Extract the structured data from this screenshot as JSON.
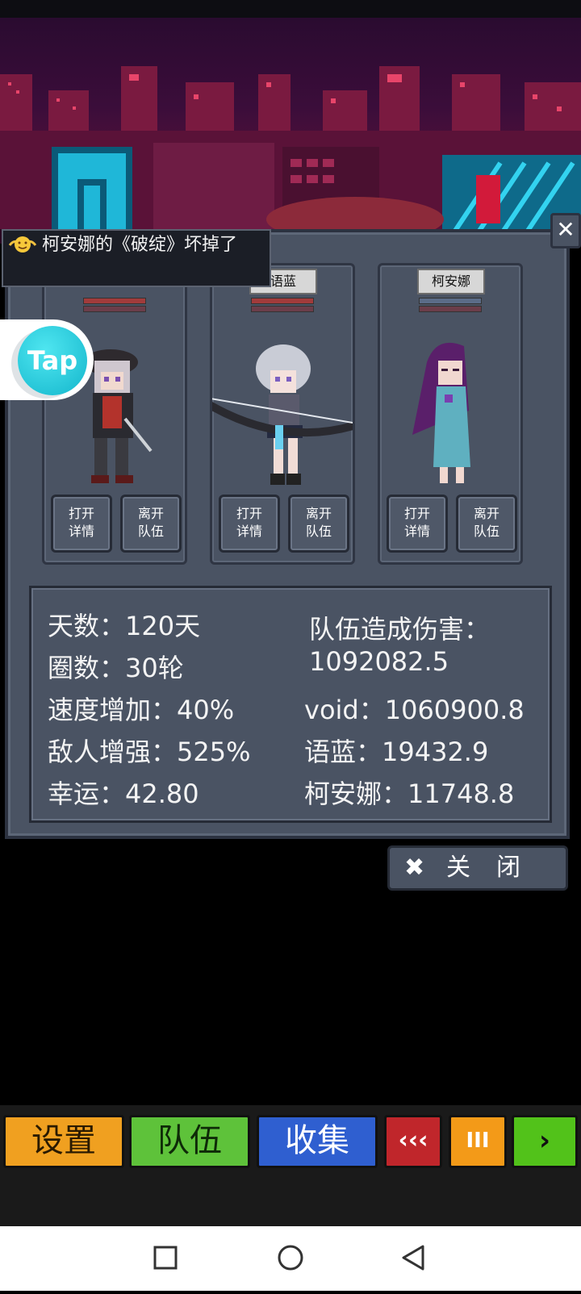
{
  "toast": {
    "message": "柯安娜的《破绽》坏掉了"
  },
  "party": {
    "slots": [
      {
        "name": "",
        "open_label_1": "打开",
        "open_label_2": "详情",
        "leave_label_1": "离开",
        "leave_label_2": "队伍"
      },
      {
        "name": "语蓝",
        "open_label_1": "打开",
        "open_label_2": "详情",
        "leave_label_1": "离开",
        "leave_label_2": "队伍"
      },
      {
        "name": "柯安娜",
        "open_label_1": "打开",
        "open_label_2": "详情",
        "leave_label_1": "离开",
        "leave_label_2": "队伍"
      }
    ]
  },
  "stats": {
    "days": "天数：120天",
    "laps": "圈数：30轮",
    "speed": "速度增加：40%",
    "enemy": "敌人增强：525%",
    "luck": "幸运：42.80",
    "damage_title": "队伍造成伤害：",
    "damage_total": "1092082.5",
    "void": "void：1060900.8",
    "yulan": "语蓝：19432.9",
    "keanna": "柯安娜：11748.8"
  },
  "close_button": {
    "icon": "✖",
    "label": "关闭"
  },
  "panel_close_icon": "✕",
  "tap": {
    "label": "Tap"
  },
  "menu": {
    "settings": "设置",
    "team": "队伍",
    "collect": "收集",
    "rewind": "‹‹‹",
    "pause": "III",
    "play": "›"
  },
  "colors": {
    "settings": "#f0a020",
    "team": "#5ec23a",
    "collect": "#2f5fd0",
    "rewind": "#c0262b",
    "pause": "#f39a18",
    "play": "#52c21a"
  }
}
